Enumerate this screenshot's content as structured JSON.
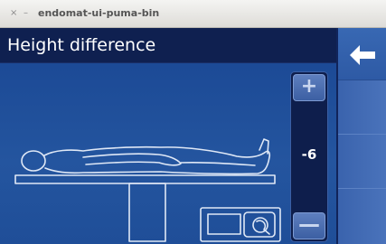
{
  "window": {
    "title": "endomat-ui-puma-bin",
    "close_glyph": "×",
    "minimize_glyph": "–"
  },
  "header": {
    "title": "Height difference"
  },
  "height_stepper": {
    "value": "-6",
    "increase_glyph": "+",
    "decrease_glyph": "—"
  },
  "icons": {
    "back": "arrow-left-icon",
    "patient": "patient-on-table-icon",
    "device": "endomat-device-icon"
  },
  "colors": {
    "header_bg": "#0f2050",
    "panel_bg": "#24559f",
    "drawing_line": "#dfe8f6",
    "stepper_bg": "#0e1e4c",
    "sidebar_bg": "#4a73bb"
  }
}
